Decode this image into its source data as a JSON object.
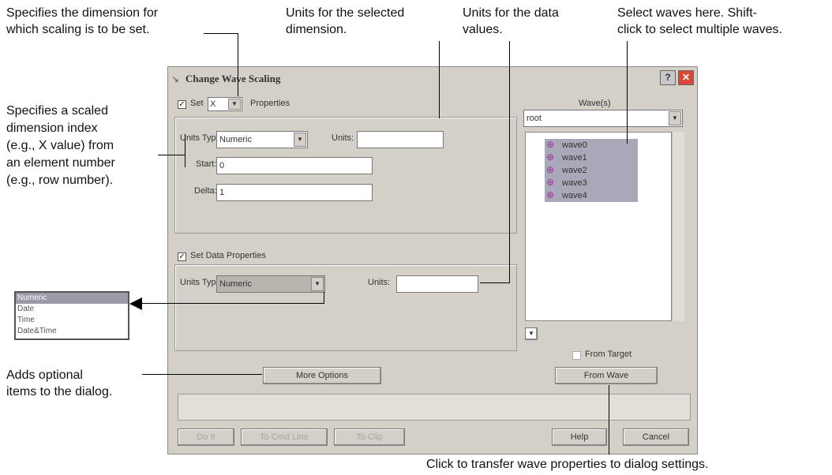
{
  "annotations": {
    "dimension": [
      "Specifies the dimension for",
      "which scaling is to be set."
    ],
    "units_dim": [
      "Units for the selected",
      "dimension."
    ],
    "units_data": [
      "Units for the data",
      "values."
    ],
    "select_waves": [
      "Select waves here. Shift-",
      "click to select multiple waves."
    ],
    "scaled_index": [
      "Specifies a scaled",
      "dimension index",
      "(e.g., X value) from",
      "an element number",
      "(e.g., row number)."
    ],
    "adds_options": [
      "Adds optional",
      "items to the dialog."
    ],
    "transfer": "Click to transfer wave properties to dialog settings."
  },
  "dialog": {
    "title": "Change Wave Scaling",
    "help_glyph": "?",
    "close_glyph": "✕",
    "set_label": "Set",
    "dim_value": "X",
    "properties_label": "Properties",
    "dim_group": {
      "units_type_label": "Units Type:",
      "units_type_value": "Numeric",
      "units_label": "Units:",
      "units_value": "",
      "start_label": "Start:",
      "start_value": "0",
      "delta_label": "Delta:",
      "delta_value": "1"
    },
    "data_check_label": "Set Data Properties",
    "data_group": {
      "units_type_label": "Units Type:",
      "units_type_value": "Numeric",
      "units_label": "Units:",
      "units_value": ""
    },
    "waves_label": "Wave(s)",
    "folder_value": "root",
    "waves": [
      "wave0",
      "wave1",
      "wave2",
      "wave3",
      "wave4"
    ],
    "from_target_label": "From Target",
    "from_wave_label": "From Wave",
    "more_options_label": "More Options",
    "bottom_buttons": [
      "Do It",
      "To Cmd Line",
      "To Clip"
    ],
    "help_label": "Help",
    "cancel_label": "Cancel"
  },
  "popup_options": [
    "Numeric",
    "Date",
    "Time",
    "Date&Time"
  ],
  "colors": {
    "dialog_bg": "#d4d0c8",
    "selection": "#a8a8b8",
    "close": "#d84838"
  }
}
